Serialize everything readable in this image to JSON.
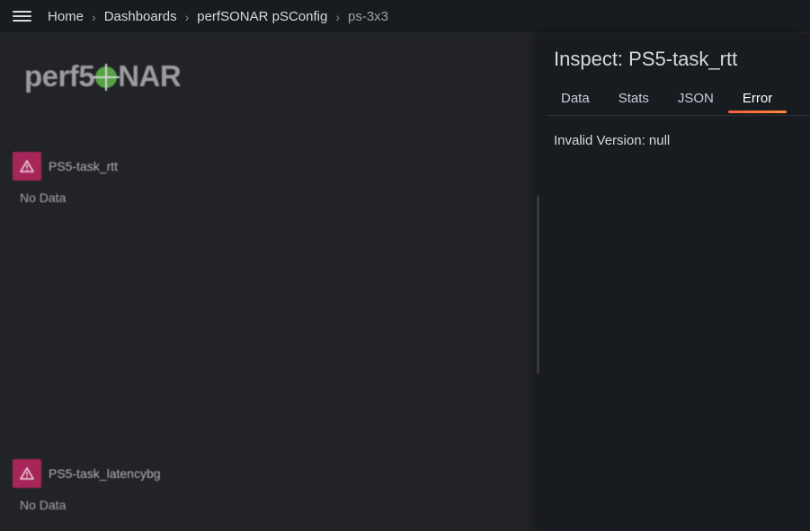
{
  "topbar": {
    "menu_icon": "hamburger-menu-icon",
    "breadcrumbs": [
      "Home",
      "Dashboards",
      "perfSONAR pSConfig",
      "ps-3x3"
    ]
  },
  "dashboard": {
    "logo_text_left": "perf",
    "logo_text_5": "5",
    "logo_text_right": "NAR",
    "panels": [
      {
        "title": "PS5-task_rtt",
        "status": "No Data",
        "icon": "warning-triangle-icon"
      },
      {
        "title": "PS5-task_latencybg",
        "status": "No Data",
        "icon": "warning-triangle-icon"
      }
    ]
  },
  "inspect": {
    "title": "Inspect: PS5-task_rtt",
    "tabs": [
      "Data",
      "Stats",
      "JSON",
      "Error"
    ],
    "active_tab": "Error",
    "error_message": "Invalid Version: null"
  },
  "colors": {
    "accent_tab": "#ff7a3d",
    "warning_badge": "#a7265a",
    "logo_green": "#55a247"
  }
}
